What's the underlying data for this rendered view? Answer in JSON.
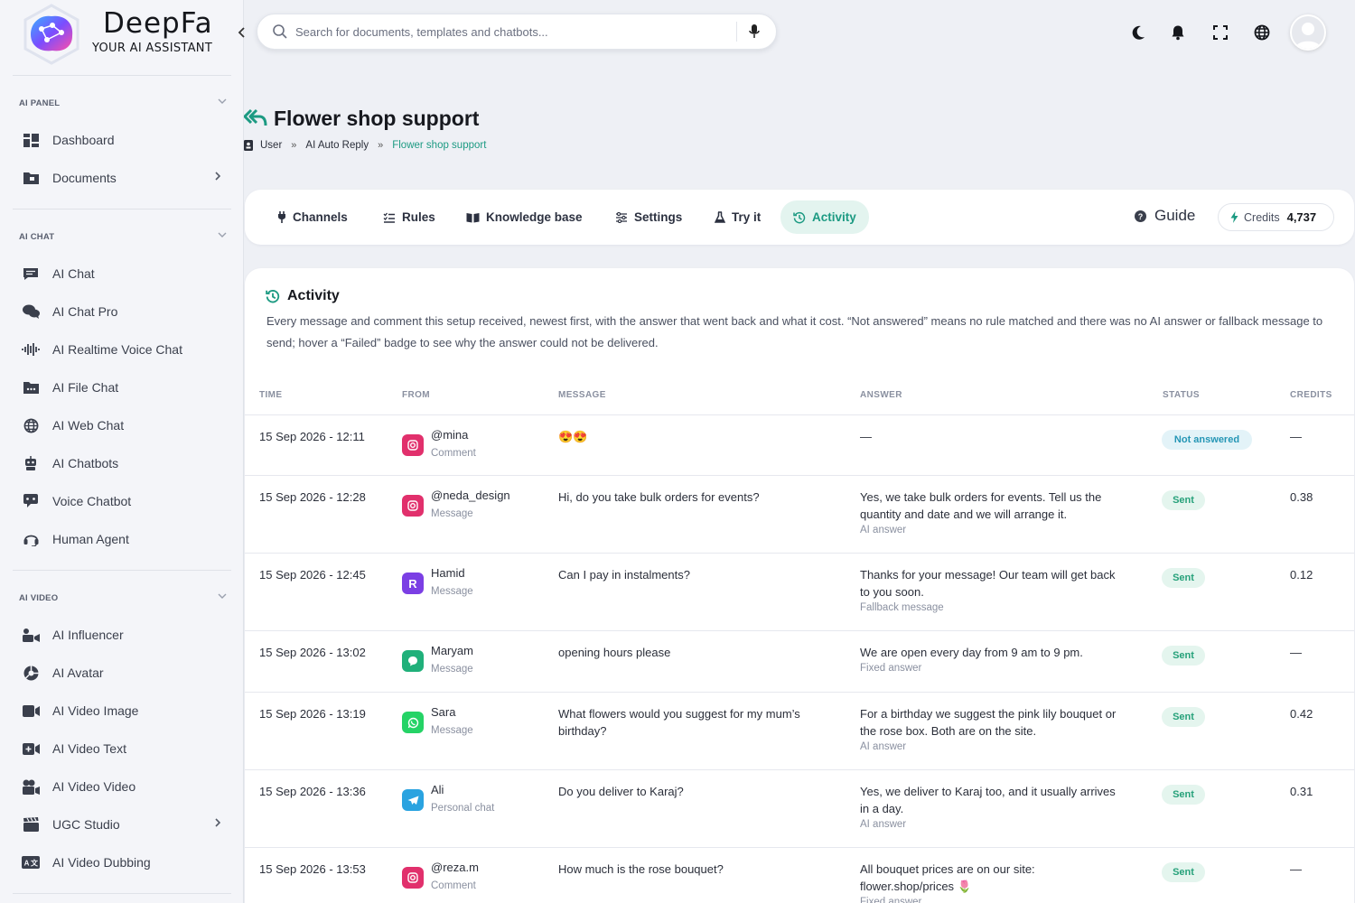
{
  "brand": {
    "name": "DeepFa",
    "tagline": "YOUR AI ASSISTANT"
  },
  "search": {
    "placeholder": "Search for documents, templates and chatbots..."
  },
  "sidebar": {
    "sections": [
      {
        "title": "AI PANEL",
        "items": [
          {
            "label": "Dashboard",
            "icon": "dashboard-icon",
            "has_arrow": false
          },
          {
            "label": "Documents",
            "icon": "folder-icon",
            "has_arrow": true
          }
        ]
      },
      {
        "title": "AI CHAT",
        "items": [
          {
            "label": "AI Chat",
            "icon": "chat-icon",
            "has_arrow": false
          },
          {
            "label": "AI Chat Pro",
            "icon": "chats-icon",
            "has_arrow": false
          },
          {
            "label": "AI Realtime Voice Chat",
            "icon": "waveform-icon",
            "has_arrow": false
          },
          {
            "label": "AI File Chat",
            "icon": "file-chat-icon",
            "has_arrow": false
          },
          {
            "label": "AI Web Chat",
            "icon": "globe-icon",
            "has_arrow": false
          },
          {
            "label": "AI Chatbots",
            "icon": "robot-icon",
            "has_arrow": false
          },
          {
            "label": "Voice Chatbot",
            "icon": "voice-bot-icon",
            "has_arrow": false
          },
          {
            "label": "Human Agent",
            "icon": "headset-icon",
            "has_arrow": false
          }
        ]
      },
      {
        "title": "AI VIDEO",
        "items": [
          {
            "label": "AI Influencer",
            "icon": "influencer-icon",
            "has_arrow": false
          },
          {
            "label": "AI Avatar",
            "icon": "avatar-icon",
            "has_arrow": false
          },
          {
            "label": "AI Video Image",
            "icon": "video-camera-icon",
            "has_arrow": false
          },
          {
            "label": "AI Video Text",
            "icon": "video-text-icon",
            "has_arrow": false
          },
          {
            "label": "AI Video Video",
            "icon": "film-camera-icon",
            "has_arrow": false
          },
          {
            "label": "UGC Studio",
            "icon": "clapper-icon",
            "has_arrow": true
          },
          {
            "label": "AI Video Dubbing",
            "icon": "dubbing-icon",
            "has_arrow": false
          }
        ]
      }
    ]
  },
  "page": {
    "title": "Flower shop support",
    "breadcrumb": [
      "User",
      "AI Auto Reply",
      "Flower shop support"
    ],
    "breadcrumb_sep": "»"
  },
  "tabs": [
    {
      "label": "Channels",
      "icon": "plug-icon",
      "active": false
    },
    {
      "label": "Rules",
      "icon": "list-icon",
      "active": false
    },
    {
      "label": "Knowledge base",
      "icon": "book-icon",
      "active": false
    },
    {
      "label": "Settings",
      "icon": "sliders-icon",
      "active": false
    },
    {
      "label": "Try it",
      "icon": "flask-icon",
      "active": false
    },
    {
      "label": "Activity",
      "icon": "history-icon",
      "active": true
    }
  ],
  "guide_label": "Guide",
  "credits": {
    "label": "Credits",
    "value": "4,737"
  },
  "activity": {
    "title": "Activity",
    "description": "Every message and comment this setup received, newest first, with the answer that went back and what it cost. “Not answered” means no rule matched and there was no AI answer or fallback message to send; hover a “Failed” badge to see why the answer could not be delivered.",
    "columns": [
      "TIME",
      "FROM",
      "MESSAGE",
      "ANSWER",
      "STATUS",
      "CREDITS"
    ],
    "rows": [
      {
        "time": "15 Sep 2026 - 12:11",
        "channel": "instagram",
        "from": "@mina",
        "from_type": "Comment",
        "message": "😍😍",
        "answer": "—",
        "answer_source": "",
        "status": "Not answered",
        "credits": "—"
      },
      {
        "time": "15 Sep 2026 - 12:28",
        "channel": "instagram",
        "from": "@neda_design",
        "from_type": "Message",
        "message": "Hi, do you take bulk orders for events?",
        "answer": "Yes, we take bulk orders for events. Tell us the quantity and date and we will arrange it.",
        "answer_source": "AI answer",
        "status": "Sent",
        "credits": "0.38"
      },
      {
        "time": "15 Sep 2026 - 12:45",
        "channel": "rubika",
        "from": "Hamid",
        "from_type": "Message",
        "message": "Can I pay in instalments?",
        "answer": "Thanks for your message! Our team will get back to you soon.",
        "answer_source": "Fallback message",
        "status": "Sent",
        "credits": "0.12"
      },
      {
        "time": "15 Sep 2026 - 13:02",
        "channel": "chat",
        "from": "Maryam",
        "from_type": "Message",
        "message": "opening hours please",
        "answer": "We are open every day from 9 am to 9 pm.",
        "answer_source": "Fixed answer",
        "status": "Sent",
        "credits": "—"
      },
      {
        "time": "15 Sep 2026 - 13:19",
        "channel": "whatsapp",
        "from": "Sara",
        "from_type": "Message",
        "message": "What flowers would you suggest for my mum’s birthday?",
        "answer": "For a birthday we suggest the pink lily bouquet or the rose box. Both are on the site.",
        "answer_source": "AI answer",
        "status": "Sent",
        "credits": "0.42"
      },
      {
        "time": "15 Sep 2026 - 13:36",
        "channel": "telegram",
        "from": "Ali",
        "from_type": "Personal chat",
        "message": "Do you deliver to Karaj?",
        "answer": "Yes, we deliver to Karaj too, and it usually arrives in a day.",
        "answer_source": "AI answer",
        "status": "Sent",
        "credits": "0.31"
      },
      {
        "time": "15 Sep 2026 - 13:53",
        "channel": "instagram",
        "from": "@reza.m",
        "from_type": "Comment",
        "message": "How much is the rose bouquet?",
        "answer": "All bouquet prices are on our site: flower.shop/prices 🌷",
        "answer_source": "Fixed answer",
        "status": "Sent",
        "credits": "—"
      }
    ]
  },
  "colors": {
    "accent": "#1c9a82",
    "instagram": "#e1306c",
    "rubika": "#7b3fe4",
    "chat": "#20b07a",
    "whatsapp": "#25d366",
    "telegram": "#2aa3e0"
  }
}
